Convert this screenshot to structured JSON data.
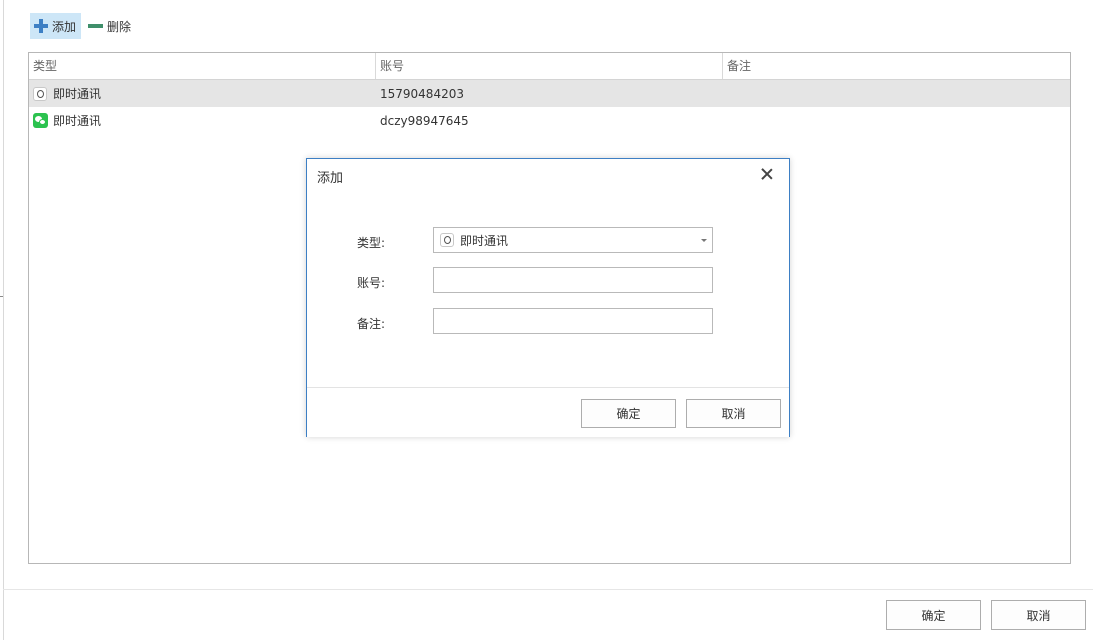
{
  "toolbar": {
    "add_label": "添加",
    "delete_label": "删除"
  },
  "grid": {
    "columns": [
      "类型",
      "账号",
      "备注"
    ],
    "rows": [
      {
        "type": "即时通讯",
        "icon": "qq-icon",
        "account": "15790484203",
        "note": ""
      },
      {
        "type": "即时通讯",
        "icon": "wechat-icon",
        "account": "dczy98947645",
        "note": ""
      }
    ],
    "selected_row": 0
  },
  "dialog": {
    "title": "添加",
    "type_label": "类型:",
    "type_value": "即时通讯",
    "type_icon": "qq-icon",
    "account_label": "账号:",
    "account_value": "",
    "note_label": "备注:",
    "note_value": "",
    "ok_label": "确定",
    "cancel_label": "取消"
  },
  "footer": {
    "ok_label": "确定",
    "cancel_label": "取消"
  },
  "colors": {
    "accent": "#3d7fc4",
    "selected_row": "#e5e5e5",
    "toolbar_active": "#cde6f7",
    "delete_icon": "#3f8f6b",
    "wechat": "#2cc24f"
  }
}
